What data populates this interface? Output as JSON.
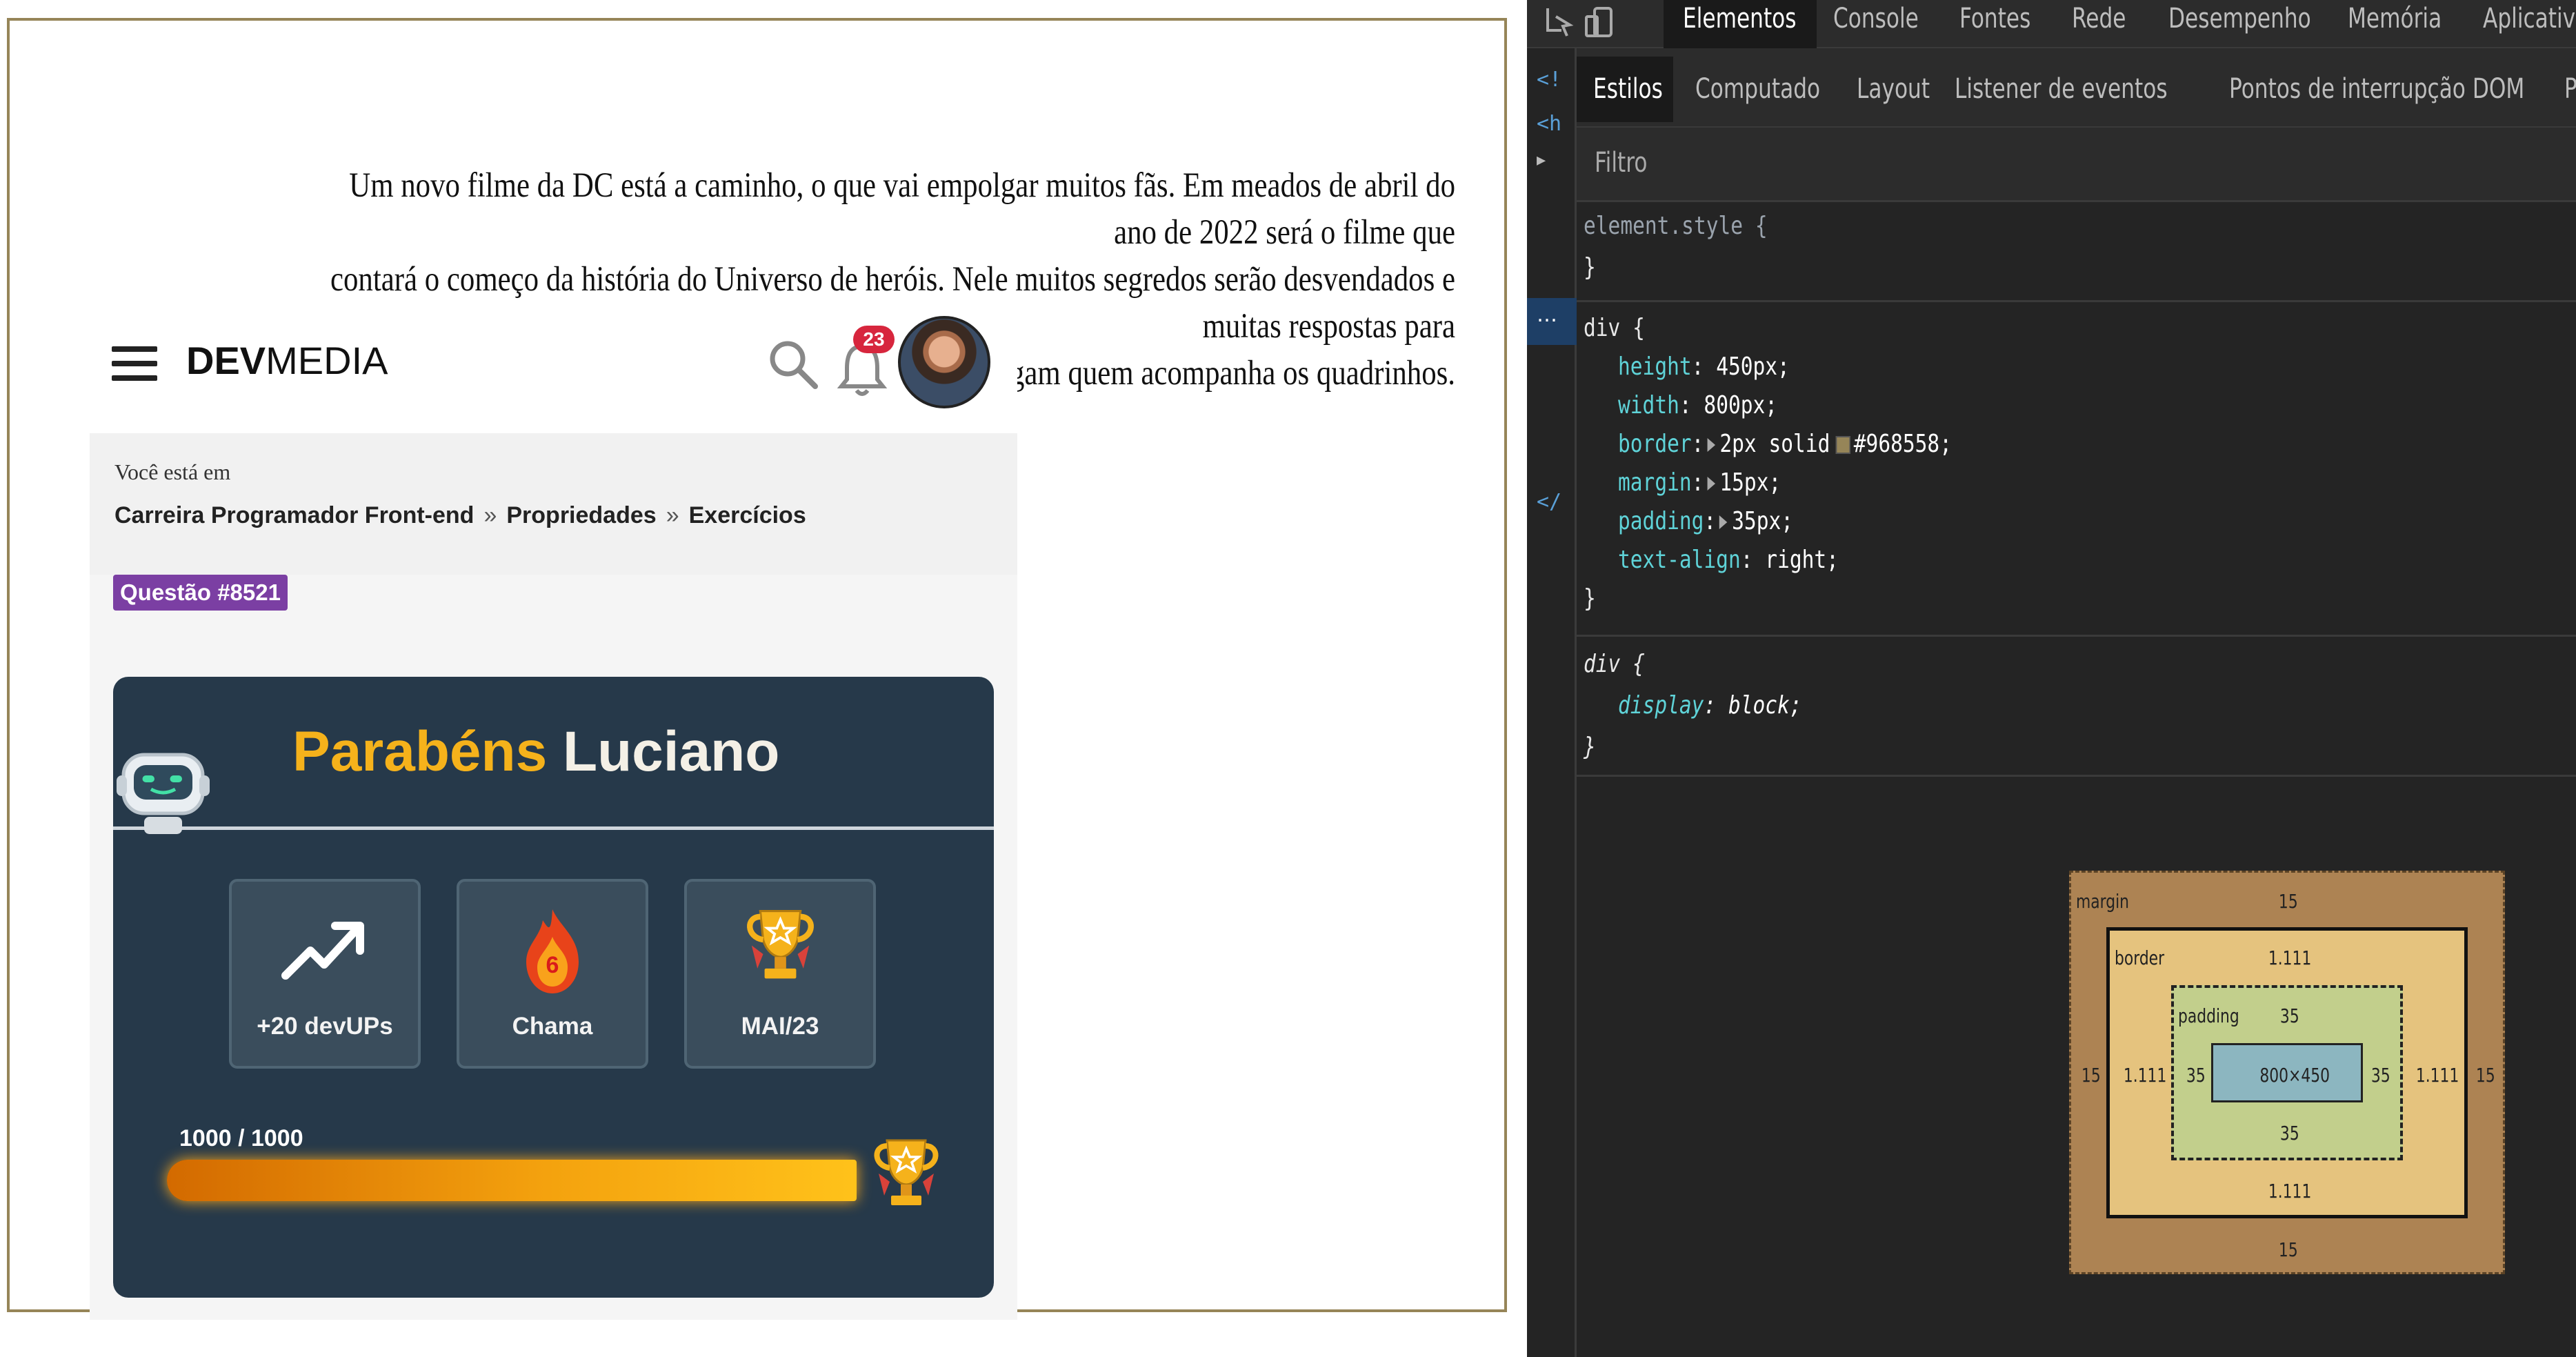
{
  "page": {
    "paragraph_lines": [
      "Um novo filme da DC está a caminho, o que vai empolgar muitos fãs. Em meados de abril do ano de 2022 será o filme que",
      "contará o começo da história do Universo de heróis. Nele muitos segredos serão desvendados e muitas respostas para",
      "mistérios que até hoje intrigam quem acompanha os quadrinhos."
    ],
    "header": {
      "logo_bold": "DEV",
      "logo_light": "MEDIA",
      "notification_count": "23"
    },
    "breadcrumb": {
      "prefix": "Você está em",
      "items": [
        "Carreira Programador Front-end",
        "Propriedades",
        "Exercícios"
      ],
      "separator": "»"
    },
    "question_badge": "Questão #8521",
    "card": {
      "title_word1": "Parabéns",
      "title_word2": "Luciano",
      "stats": [
        {
          "icon": "trend-up-icon",
          "label": "+20 devUPs"
        },
        {
          "icon": "flame-icon",
          "label": "Chama",
          "value": "6"
        },
        {
          "icon": "trophy-icon",
          "label": "MAI/23"
        }
      ],
      "progress_text": "1000 / 1000",
      "progress_fraction": 1.0
    }
  },
  "devtools": {
    "tabs": [
      "Elementos",
      "Console",
      "Fontes",
      "Rede",
      "Desempenho",
      "Memória",
      "Aplicativo"
    ],
    "active_tab": "Elementos",
    "subtabs": [
      "Estilos",
      "Computado",
      "Layout",
      "Listener de eventos",
      "Pontos de interrupção DOM",
      "Propriedades"
    ],
    "active_subtab": "Estilos",
    "filter_placeholder": "Filtro",
    "gutter_markers": [
      "<!",
      "<h",
      "</"
    ],
    "gutter_selected": "…",
    "rules": {
      "element_style": {
        "selector": "element.style {",
        "close": "}"
      },
      "div1": {
        "selector": "div {",
        "props": [
          {
            "name": "height",
            "value": "450px;"
          },
          {
            "name": "width",
            "value": "800px;"
          },
          {
            "name": "border",
            "value": "2px solid",
            "color": "#968558",
            "tail": "#968558;"
          },
          {
            "name": "margin",
            "value": "15px;"
          },
          {
            "name": "padding",
            "value": "35px;"
          },
          {
            "name": "text-align",
            "value": "right;"
          }
        ],
        "close": "}"
      },
      "div2": {
        "selector": "div {",
        "props": [
          {
            "name": "display",
            "value": "block;"
          }
        ],
        "close": "}"
      }
    },
    "box_model": {
      "margin_label": "margin",
      "margin": {
        "top": "15",
        "right": "15",
        "bottom": "15",
        "left": "15"
      },
      "border_label": "border",
      "border": {
        "top": "1.111",
        "right": "1.111",
        "bottom": "1.111",
        "left": "1.111"
      },
      "padding_label": "padding",
      "padding": {
        "top": "35",
        "right": "35",
        "bottom": "35",
        "left": "35"
      },
      "content": "800×450"
    }
  },
  "colors": {
    "demo_border": "#968558",
    "badge_purple": "#7b3fa3",
    "card_bg": "#26394a",
    "gold": "#f5b21b"
  }
}
